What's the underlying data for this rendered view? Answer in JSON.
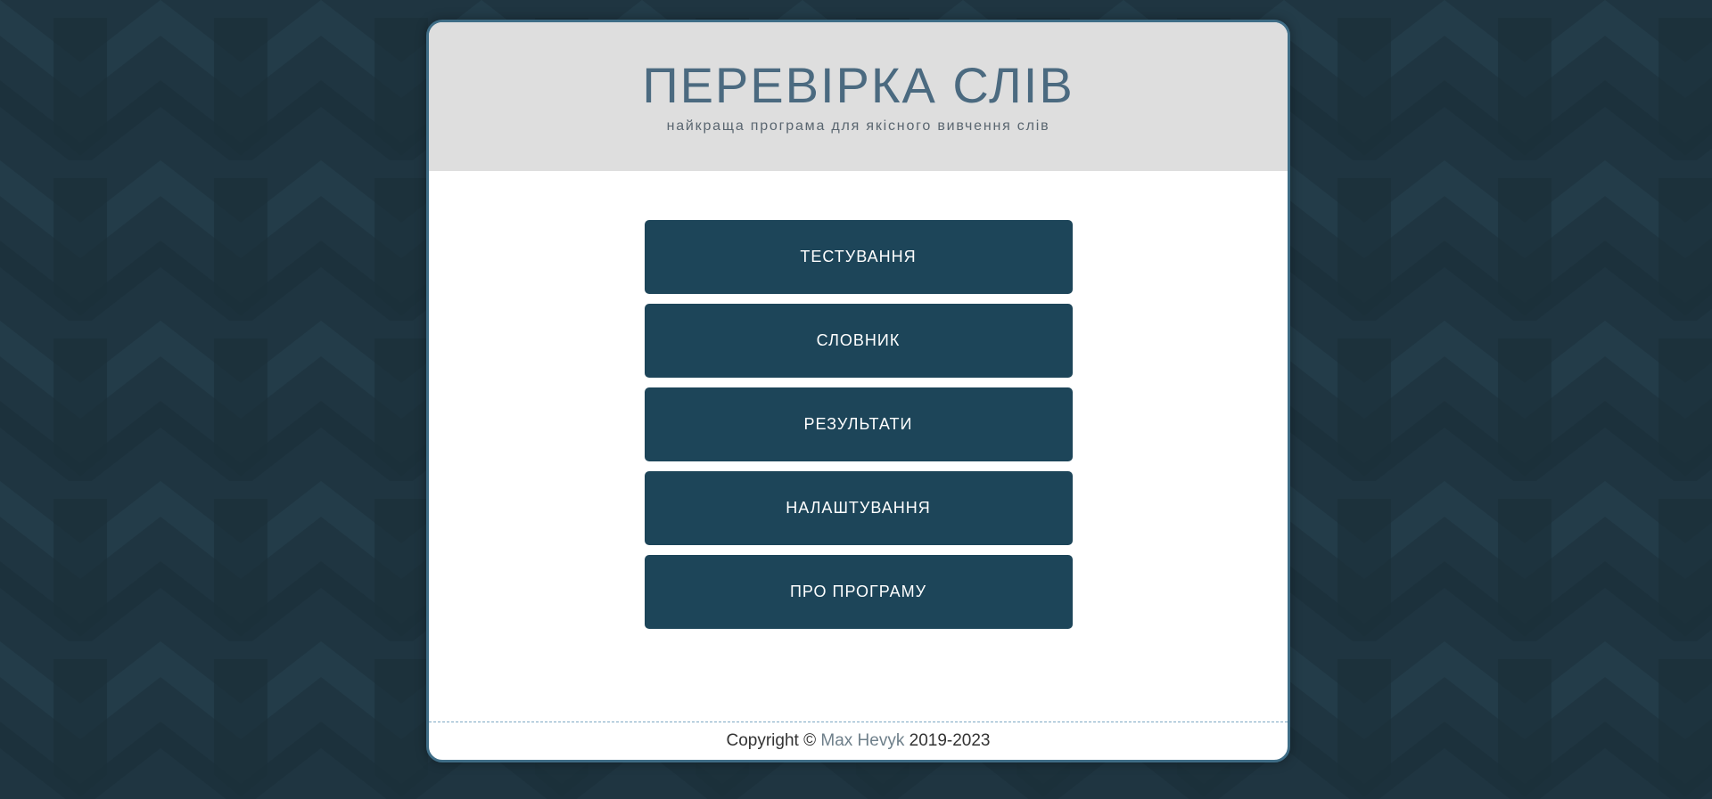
{
  "header": {
    "title": "ПЕРЕВІРКА СЛІВ",
    "subtitle": "найкраща програма для якісного вивчення слів"
  },
  "menu": {
    "items": [
      {
        "label": "ТЕСТУВАННЯ"
      },
      {
        "label": "СЛОВНИК"
      },
      {
        "label": "РЕЗУЛЬТАТИ"
      },
      {
        "label": "НАЛАШТУВАННЯ"
      },
      {
        "label": "ПРО ПРОГРАМУ"
      }
    ]
  },
  "footer": {
    "prefix": "Copyright ©",
    "author": "Max Hevyk",
    "years": "2019-2023"
  },
  "colors": {
    "background": "#1f3541",
    "button": "#1d4559",
    "title": "#4b6a80",
    "header_bg": "#dedede",
    "card_border": "#3f6d86"
  }
}
